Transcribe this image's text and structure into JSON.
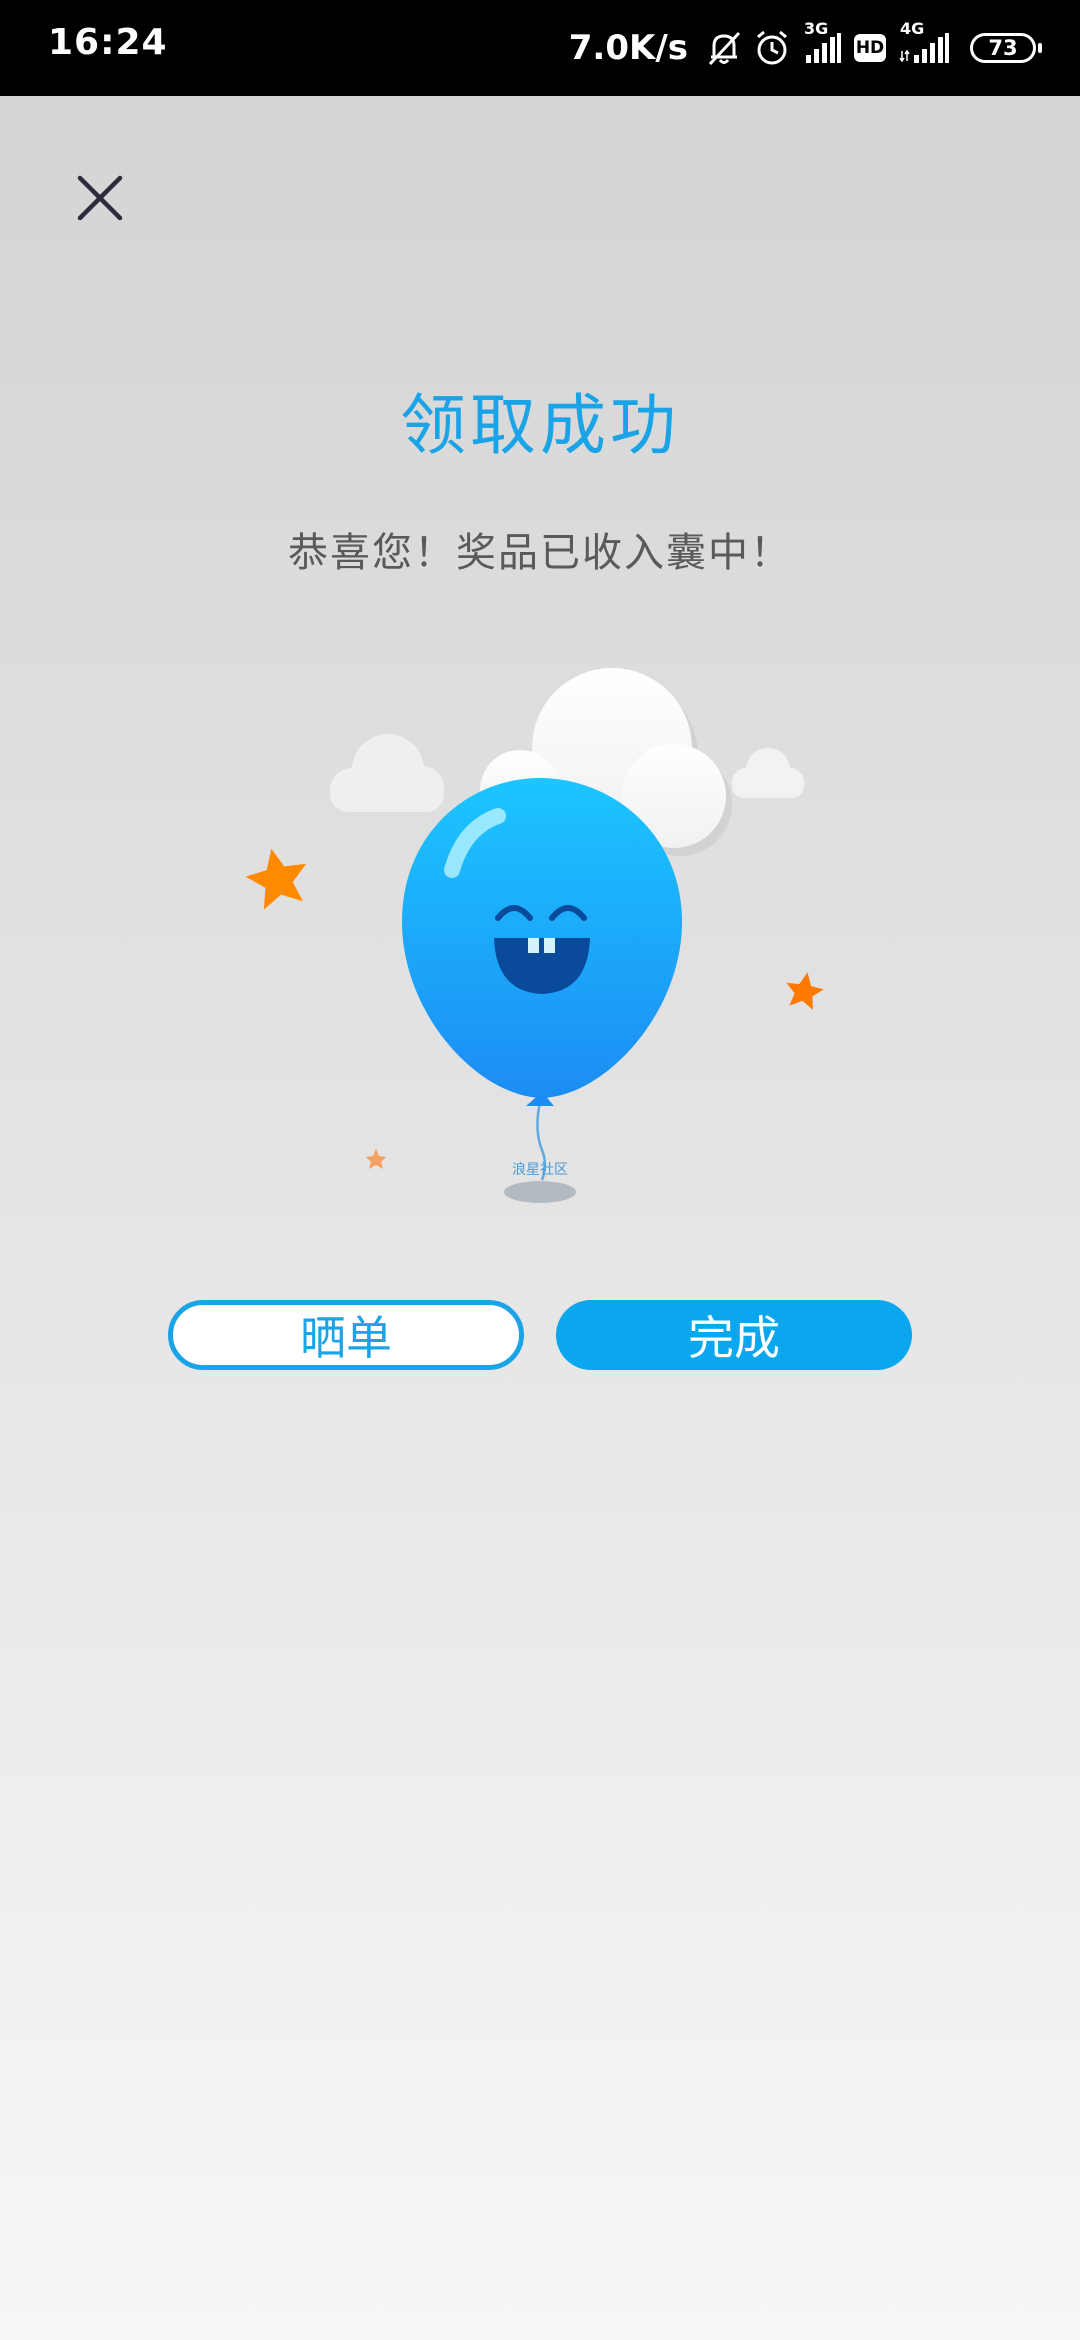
{
  "status_bar": {
    "time": "16:24",
    "net_speed": "7.0K/s",
    "sim1_network": "3G",
    "hd_label": "HD",
    "sim2_network": "4G",
    "battery_level": "73",
    "icons": [
      "bell-off-icon",
      "alarm-icon",
      "signal-icon",
      "hd-icon",
      "signal-icon",
      "battery-icon"
    ]
  },
  "close_icon": "close-icon",
  "result": {
    "title": "领取成功",
    "message": "恭喜您！奖品已收入囊中！"
  },
  "illustration": {
    "caption": "浪星社区",
    "balloon_color": "#1ba8f4",
    "star_color": "#ff8a00"
  },
  "actions": {
    "share_label": "晒单",
    "done_label": "完成"
  },
  "colors": {
    "accent": "#1aa3e6",
    "primary_button": "#0aa7ef"
  }
}
